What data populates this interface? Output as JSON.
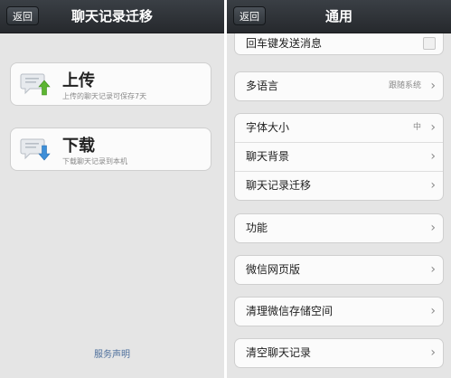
{
  "left": {
    "back_label": "返回",
    "title": "聊天记录迁移",
    "upload": {
      "title": "上传",
      "desc": "上传的聊天记录可保存7天"
    },
    "download": {
      "title": "下载",
      "desc": "下载聊天记录到本机"
    },
    "footer_link": "服务声明"
  },
  "right": {
    "back_label": "返回",
    "title": "通用",
    "rows": {
      "enter_send": "回车键发送消息",
      "language": "多语言",
      "language_value": "跟随系统",
      "font_size": "字体大小",
      "font_size_value": "中",
      "chat_background": "聊天背景",
      "chat_migration": "聊天记录迁移",
      "features": "功能",
      "web_version": "微信网页版",
      "clean_storage": "清理微信存储空间",
      "clear_history": "清空聊天记录"
    }
  },
  "icons": {
    "upload_arrow_color": "#5cb531",
    "download_arrow_color": "#3e8fd8"
  }
}
